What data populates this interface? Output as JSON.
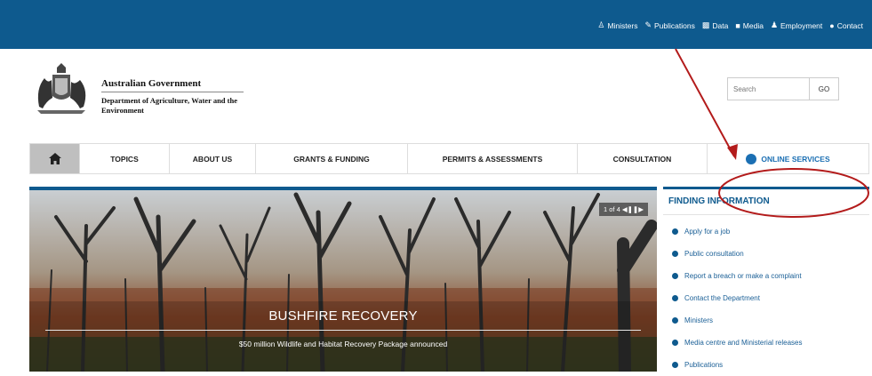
{
  "top_links": [
    {
      "label": "Ministers",
      "icon": "person-icon"
    },
    {
      "label": "Publications",
      "icon": "pen-icon"
    },
    {
      "label": "Data",
      "icon": "bar-chart-icon"
    },
    {
      "label": "Media",
      "icon": "video-camera-icon"
    },
    {
      "label": "Employment",
      "icon": "people-icon"
    },
    {
      "label": "Contact",
      "icon": "speech-bubble-icon"
    }
  ],
  "brand": {
    "government": "Australian Government",
    "department": "Department of Agriculture, Water and the Environment"
  },
  "search": {
    "placeholder": "Search",
    "button": "GO"
  },
  "nav": {
    "home_icon": "home-icon",
    "items": [
      "TOPICS",
      "ABOUT US",
      "GRANTS & FUNDING",
      "PERMITS & ASSESSMENTS",
      "CONSULTATION",
      "ONLINE SERVICES"
    ]
  },
  "hero": {
    "counter": "1 of 4",
    "controls": [
      "prev-icon",
      "pause-icon",
      "next-icon"
    ],
    "title": "BUSHFIRE RECOVERY",
    "subtitle": "$50 million Wildlife and Habitat Recovery Package announced"
  },
  "sidebar": {
    "title": "FINDING INFORMATION",
    "items": [
      "Apply for a job",
      "Public consultation",
      "Report a breach or make a complaint",
      "Contact the Department",
      "Ministers",
      "Media centre and Ministerial releases",
      "Publications"
    ]
  },
  "annotation_color": "#b31b1b",
  "brand_color": "#0e5a8e"
}
